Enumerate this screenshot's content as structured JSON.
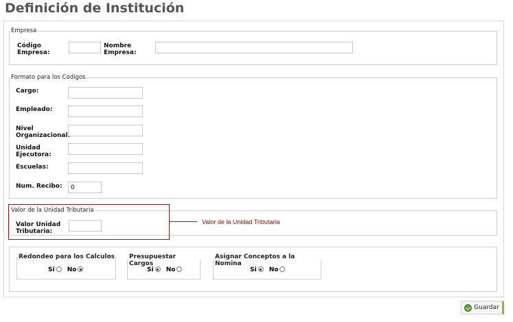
{
  "page_title": "Definición de Institución",
  "empresa": {
    "legend": "Empresa",
    "codigo_label_1": "Código",
    "codigo_label_2": "Empresa:",
    "codigo_value": "",
    "nombre_label_1": "Nombre",
    "nombre_label_2": "Empresa:",
    "nombre_value": ""
  },
  "formato": {
    "legend": "Formato para los Codigos",
    "cargo_label": "Cargo:",
    "cargo_value": "",
    "empleado_label": "Empleado:",
    "empleado_value": "",
    "nivel_label_1": "Nivel",
    "nivel_label_2": "Organizacional:",
    "nivel_value": "",
    "unidad_label_1": "Unidad",
    "unidad_label_2": "Ejecutora:",
    "unidad_value": "",
    "escuelas_label": "Escuelas:",
    "escuelas_value": "",
    "recibo_label": "Num. Recibo:",
    "recibo_value": "0"
  },
  "unidad_tributaria": {
    "legend": "Valor de la Unidad Tributaria",
    "label_1": "Valor Unidad",
    "label_2": "Tributaria:",
    "value": "",
    "callout": "Valor de la Unidad Tributaria",
    "highlight_color": "#8b1a1a"
  },
  "opciones": {
    "redondeo": {
      "legend": "Redondeo para los Calculos",
      "si": "Si",
      "no": "No",
      "selected": "No"
    },
    "presupuestar": {
      "legend": "Presupuestar Cargos",
      "si": "Si",
      "no": "No",
      "selected": "Si"
    },
    "asignar": {
      "legend": "Asignar Conceptos a la Nomina",
      "si": "Si",
      "no": "No",
      "selected": "Si"
    }
  },
  "save_button": {
    "label": "Guardar",
    "icon": "check-circle-icon",
    "accent": "#7bbf3a"
  }
}
